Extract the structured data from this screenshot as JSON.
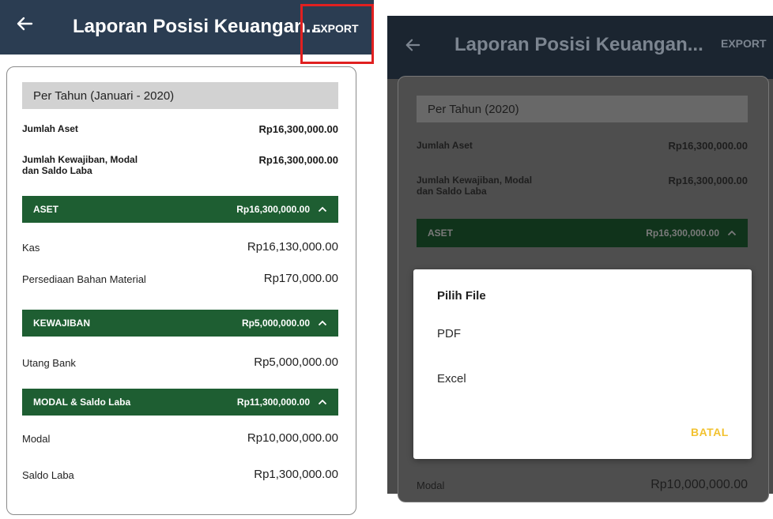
{
  "left": {
    "appbar": {
      "title": "Laporan Posisi Keuangan...",
      "export_label": "EXPORT"
    },
    "period": "Per Tahun (Januari - 2020)",
    "summary": [
      {
        "label": "Jumlah Aset",
        "value": "Rp16,300,000.00"
      },
      {
        "label_line1": "Jumlah Kewajiban, Modal",
        "label_line2": "dan Saldo Laba",
        "value": "Rp16,300,000.00"
      }
    ],
    "sections": [
      {
        "title": "ASET",
        "total": "Rp16,300,000.00",
        "rows": [
          {
            "label": "Kas",
            "value": "Rp16,130,000.00"
          },
          {
            "label": "Persediaan Bahan Material",
            "value": "Rp170,000.00"
          }
        ]
      },
      {
        "title": "KEWAJIBAN",
        "total": "Rp5,000,000.00",
        "rows": [
          {
            "label": "Utang Bank",
            "value": "Rp5,000,000.00"
          }
        ]
      },
      {
        "title": "MODAL & Saldo Laba",
        "total": "Rp11,300,000.00",
        "rows": [
          {
            "label": "Modal",
            "value": "Rp10,000,000.00"
          },
          {
            "label": "Saldo Laba",
            "value": "Rp1,300,000.00"
          }
        ]
      }
    ]
  },
  "right": {
    "appbar": {
      "title": "Laporan Posisi Keuangan...",
      "export_label": "EXPORT"
    },
    "period": "Per Tahun (2020)",
    "summary": [
      {
        "label": "Jumlah Aset",
        "value": "Rp16,300,000.00"
      },
      {
        "label_line1": "Jumlah Kewajiban, Modal",
        "label_line2": "dan Saldo Laba",
        "value": "Rp16,300,000.00"
      }
    ],
    "section": {
      "title": "ASET",
      "total": "Rp16,300,000.00"
    },
    "dialog": {
      "title": "Pilih File",
      "options": [
        "PDF",
        "Excel"
      ],
      "cancel_label": "BATAL"
    },
    "bottom_row": {
      "label": "Modal",
      "value": "Rp10,000,000.00"
    }
  },
  "colors": {
    "appbar": "#2b3d52",
    "section_green": "#1e5e32",
    "highlight_red": "#e02020",
    "cancel_yellow": "#f2c230"
  },
  "icons": {
    "back": "arrow-left",
    "collapse": "chevron-up"
  }
}
